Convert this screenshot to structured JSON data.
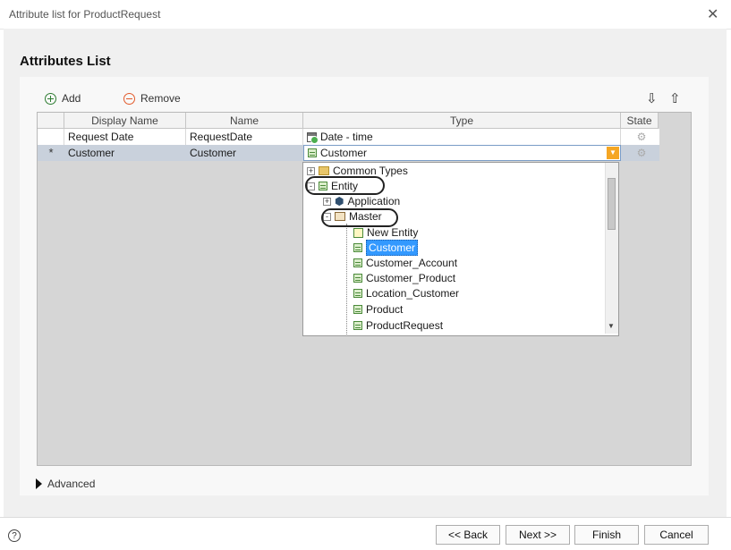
{
  "window": {
    "title": "Attribute list for ProductRequest",
    "close_icon": "close-icon"
  },
  "heading": "Attributes List",
  "toolbar": {
    "add_label": "Add",
    "remove_label": "Remove",
    "add_color": "#2e7d32",
    "remove_color": "#e25a2b"
  },
  "grid": {
    "columns": [
      "Display Name",
      "Name",
      "Type",
      "State"
    ],
    "rows": [
      {
        "indicator": "",
        "display_name": "Request Date",
        "name": "RequestDate",
        "type": "Date - time",
        "type_icon": "calendar-clock-icon",
        "state_icon": "gears-icon"
      },
      {
        "indicator": "*",
        "display_name": "Customer",
        "name": "Customer",
        "type": "Customer",
        "type_icon": "table-icon",
        "state_icon": "gears-icon"
      }
    ]
  },
  "type_dropdown": {
    "nodes": [
      {
        "label": "Common Types",
        "expander": "+",
        "icon": "folder-icon"
      },
      {
        "label": "Entity",
        "expander": "-",
        "icon": "table-icon"
      },
      {
        "label": "Application",
        "expander": "+",
        "icon": "hexagon-icon"
      },
      {
        "label": "Master",
        "expander": "-",
        "icon": "box-icon"
      },
      {
        "label": "New Entity",
        "icon": "new-entity-icon"
      },
      {
        "label": "Customer",
        "icon": "table-icon",
        "selected": true
      },
      {
        "label": "Customer_Account",
        "icon": "table-icon"
      },
      {
        "label": "Customer_Product",
        "icon": "table-icon"
      },
      {
        "label": "Location_Customer",
        "icon": "table-icon"
      },
      {
        "label": "Product",
        "icon": "table-icon"
      },
      {
        "label": "ProductRequest",
        "icon": "table-icon"
      }
    ]
  },
  "advanced_label": "Advanced",
  "footer": {
    "help": "?",
    "back": "<< Back",
    "next": "Next >>",
    "finish": "Finish",
    "cancel": "Cancel"
  },
  "colors": {
    "selection": "#3399ff",
    "row_selected": "#c9d1dc",
    "dropdown_button": "#f5a623"
  }
}
